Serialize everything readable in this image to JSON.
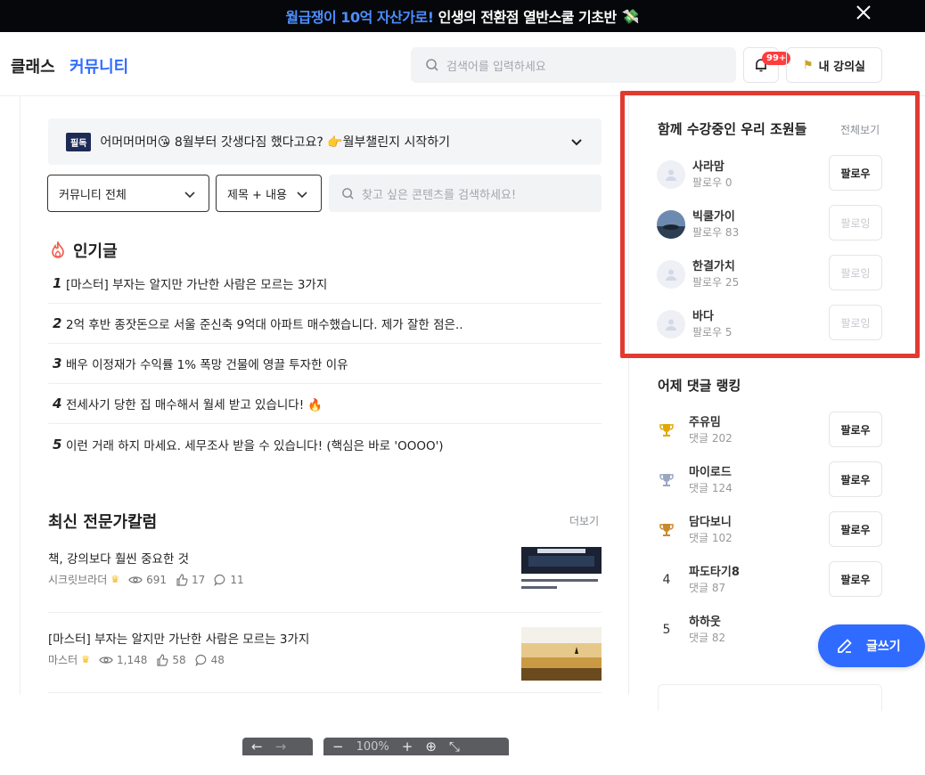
{
  "banner": {
    "highlight": "월급쟁이 10억 자산가로!",
    "text": " 인생의 전환점 열반스쿨 기초반",
    "money_icon": "💸"
  },
  "header": {
    "nav_class": "클래스",
    "nav_community": "커뮤니티",
    "search_placeholder": "검색어를 입력하세요",
    "notification_badge": "99+",
    "my_class": "내 강의실"
  },
  "notice": {
    "tag": "필독",
    "text": "어머머머머😘 8월부터 갓생다짐 했다고요? 👉월부챌린지 시작하기"
  },
  "filters": {
    "category": "커뮤니티 전체",
    "scope": "제목 + 내용",
    "search_placeholder": "찾고 싶은 콘텐츠를 검색하세요!"
  },
  "popular": {
    "title": "인기글",
    "items": [
      {
        "rank": "1",
        "text": "[마스터] 부자는 알지만 가난한 사람은 모르는 3가지"
      },
      {
        "rank": "2",
        "text": "2억 후반 종잣돈으로 서울 준신축 9억대 아파트 매수했습니다. 제가 잘한 점은.."
      },
      {
        "rank": "3",
        "text": "배우 이정재가 수익률 1% 폭망 건물에 영끌 투자한 이유"
      },
      {
        "rank": "4",
        "text": "전세사기 당한 집 매수해서 월세 받고 있습니다! 🔥"
      },
      {
        "rank": "5",
        "text": "이런 거래 하지 마세요. 세무조사 받을 수 있습니다! (핵심은 바로 'OOOO')"
      }
    ]
  },
  "columns": {
    "title": "최신 전문가칼럼",
    "more": "더보기",
    "items": [
      {
        "title": "책, 강의보다 훨씬 중요한 것",
        "author": "시크릿브라더",
        "views": "691",
        "likes": "17",
        "comments": "11"
      },
      {
        "title": "[마스터] 부자는 알지만 가난한 사람은 모르는 3가지",
        "author": "마스터",
        "views": "1,148",
        "likes": "58",
        "comments": "48"
      }
    ]
  },
  "classmates": {
    "title": "함께 수강중인 우리 조원들",
    "view_all": "전체보기",
    "members": [
      {
        "name": "사라맘",
        "sub": "팔로우 0",
        "button": "팔로우",
        "following": false
      },
      {
        "name": "빅쿨가이",
        "sub": "팔로우 83",
        "button": "팔로잉",
        "following": true
      },
      {
        "name": "한결가치",
        "sub": "팔로우 25",
        "button": "팔로잉",
        "following": true
      },
      {
        "name": "바다",
        "sub": "팔로우 5",
        "button": "팔로잉",
        "following": true
      }
    ]
  },
  "ranking": {
    "title": "어제 댓글 랭킹",
    "items": [
      {
        "rank": "1",
        "name": "주유밈",
        "sub": "댓글 202",
        "button": "팔로우"
      },
      {
        "rank": "2",
        "name": "마이로드",
        "sub": "댓글 124",
        "button": "팔로우"
      },
      {
        "rank": "3",
        "name": "담다보니",
        "sub": "댓글 102",
        "button": "팔로우"
      },
      {
        "rank": "4",
        "name": "파도타기8",
        "sub": "댓글 87",
        "button": "팔로우"
      },
      {
        "rank": "5",
        "name": "하하웃",
        "sub": "댓글 82",
        "button": "팔로우"
      }
    ]
  },
  "write_button": "글쓰기",
  "colors": {
    "accent": "#2f6bff",
    "highlight_border": "#e23a30",
    "badge": "#ff3d3d",
    "gold": "#e0a800",
    "silver": "#9aa7c2",
    "bronze": "#c98a2b"
  }
}
